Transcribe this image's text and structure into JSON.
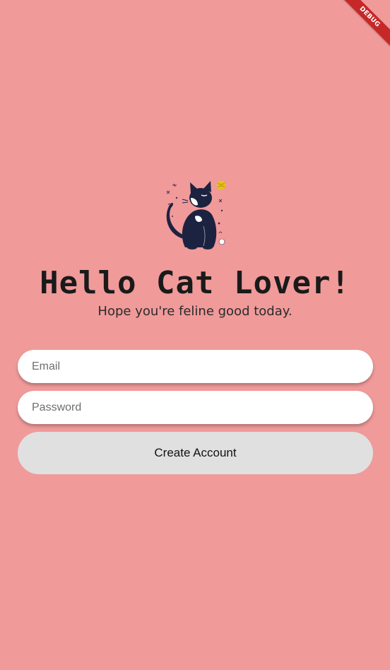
{
  "debug_banner": {
    "label": "DEBUG"
  },
  "header": {
    "logo_icon": "cat-illustration-icon",
    "title": "Hello Cat Lover!",
    "subtitle": "Hope you're feline good today."
  },
  "form": {
    "email": {
      "placeholder": "Email",
      "value": ""
    },
    "password": {
      "placeholder": "Password",
      "value": ""
    },
    "submit_label": "Create Account"
  },
  "colors": {
    "background": "#F09A9A",
    "button": "#E0E0E0",
    "field": "#FFFFFF",
    "banner": "#C62828",
    "cat": "#1C2340",
    "yarn": "#E8C020"
  }
}
